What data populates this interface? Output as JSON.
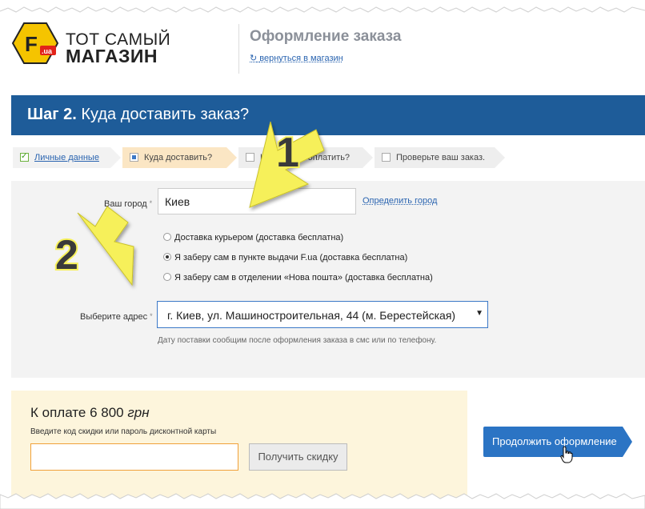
{
  "header": {
    "brand_line1": "ТОТ САМЫЙ",
    "brand_line2": "МАГАЗИН",
    "logo_letter": "F",
    "logo_badge": ".ua",
    "page_title": "Оформление заказа",
    "back_link": "вернуться в магазин",
    "back_icon": "↻"
  },
  "banner": {
    "step_prefix": "Шаг 2.",
    "step_title": "Куда доставить заказ?"
  },
  "steps": [
    {
      "label": "Личные данные",
      "state": "done"
    },
    {
      "label": "Куда доставить?",
      "state": "current"
    },
    {
      "label": "Как удобно оплатить?",
      "state": "todo"
    },
    {
      "label": "Проверьте ваш заказ.",
      "state": "todo"
    }
  ],
  "form": {
    "city_label": "Ваш город",
    "required_mark": "*",
    "city_value": "Киев",
    "detect_city_link": "Определить город",
    "delivery_options": [
      {
        "label": "Доставка курьером (доставка бесплатна)",
        "selected": false
      },
      {
        "label": "Я заберу сам в пункте выдачи F.ua (доставка бесплатна)",
        "selected": true
      },
      {
        "label": "Я заберу сам в отделении «Нова пошта» (доставка бесплатна)",
        "selected": false
      }
    ],
    "address_label": "Выберите адрес",
    "address_value": "г. Киев, ул. Машиностроительная, 44 (м. Берестейская)",
    "delivery_hint": "Дату поставки сообщим после оформления заказа в смс или по телефону."
  },
  "payment": {
    "total_prefix": "К оплате",
    "total_amount": "6 800",
    "currency": "грн",
    "promo_hint": "Введите код скидки или пароль дисконтной карты",
    "promo_value": "",
    "get_discount_button": "Получить скидку"
  },
  "continue_button": "Продолжить оформление",
  "annotations": [
    {
      "number": "1"
    },
    {
      "number": "2"
    }
  ],
  "colors": {
    "banner": "#1e5c99",
    "accent_button": "#2b74c4",
    "link": "#2a64b0",
    "current_step": "#fbe6c4",
    "payment_box": "#fdf5dc",
    "annotation_arrow": "#f6f05a"
  }
}
